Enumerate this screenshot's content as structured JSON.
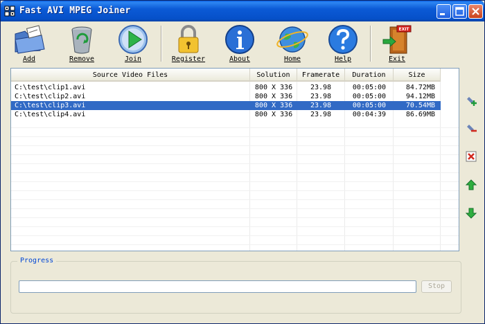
{
  "window": {
    "title": "Fast AVI MPEG Joiner"
  },
  "toolbar": {
    "add": "Add",
    "remove": "Remove",
    "join": "Join",
    "register": "Register",
    "about": "About",
    "home": "Home",
    "help": "Help",
    "exit": "Exit",
    "exit_sign": "EXIT"
  },
  "table": {
    "columns": [
      "Source Video Files",
      "Solution",
      "Framerate",
      "Duration",
      "Size"
    ],
    "rows": [
      [
        "C:\\test\\clip1.avi",
        "800 X 336",
        "23.98",
        "00:05:00",
        "84.72MB"
      ],
      [
        "C:\\test\\clip2.avi",
        "800 X 336",
        "23.98",
        "00:05:00",
        "94.12MB"
      ],
      [
        "C:\\test\\clip3.avi",
        "800 X 336",
        "23.98",
        "00:05:00",
        "70.54MB"
      ],
      [
        "C:\\test\\clip4.avi",
        "800 X 336",
        "23.98",
        "00:04:39",
        "86.69MB"
      ]
    ],
    "selected_row": 2
  },
  "side_buttons": [
    "add-file-icon",
    "remove-file-icon",
    "delete-all-icon",
    "move-up-icon",
    "move-down-icon"
  ],
  "progress": {
    "label": "Progress",
    "stop_label": "Stop",
    "value": 0
  },
  "colors": {
    "title_blue": "#0a5fe2",
    "selection": "#316ac5",
    "legend": "#0046d5"
  }
}
